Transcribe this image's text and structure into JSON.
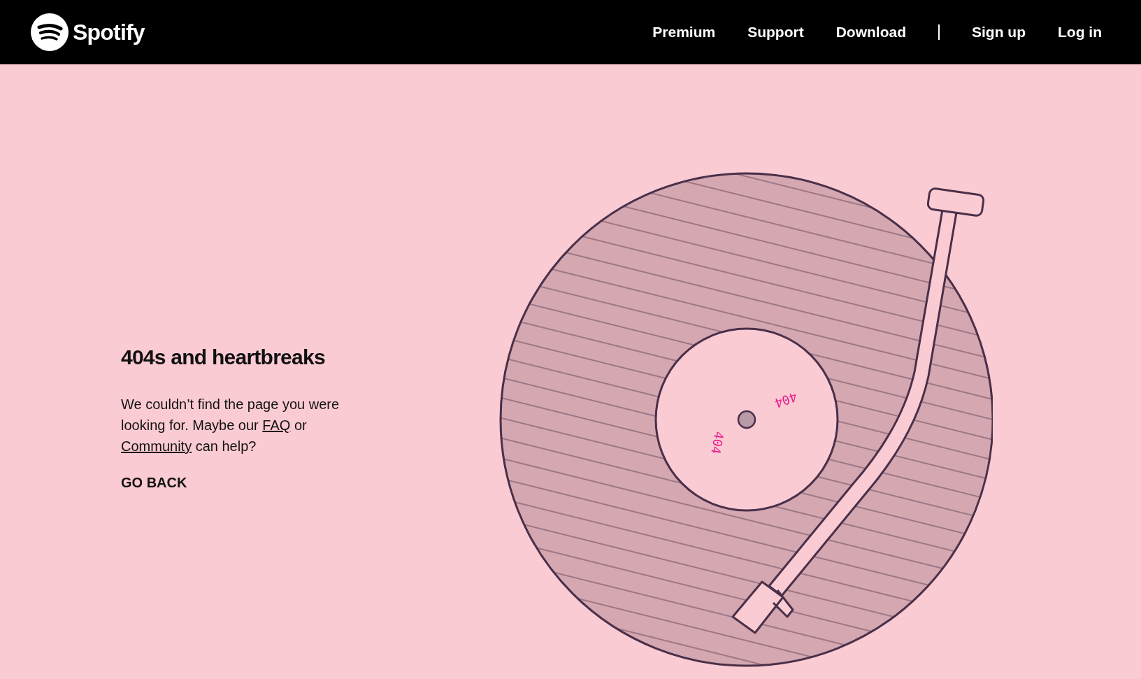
{
  "header": {
    "brand": "Spotify",
    "nav": [
      {
        "label": "Premium",
        "kind": "link"
      },
      {
        "label": "Support",
        "kind": "link"
      },
      {
        "label": "Download",
        "kind": "link"
      },
      {
        "kind": "divider"
      },
      {
        "label": "Sign up",
        "kind": "link"
      },
      {
        "label": "Log in",
        "kind": "link"
      }
    ]
  },
  "error": {
    "title": "404s and heartbreaks",
    "message_start": "We couldn’t find the page you were looking for. Maybe our ",
    "faq_link": "FAQ",
    "message_middle": " or ",
    "community_link": "Community",
    "message_end": " can help?",
    "back_link": "GO BACK"
  },
  "record": {
    "labels": [
      "404",
      "404"
    ]
  }
}
